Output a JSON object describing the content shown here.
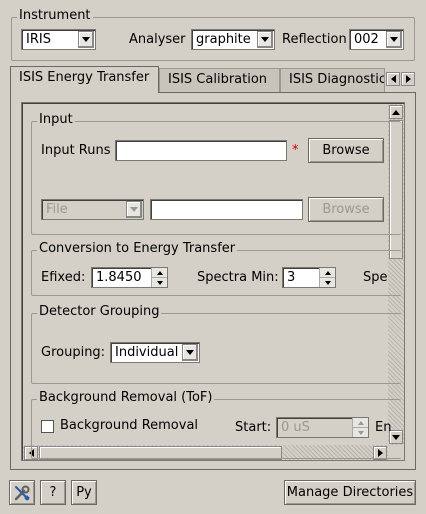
{
  "instrument": {
    "group_title": "Instrument",
    "instrument_value": "IRIS",
    "analyser_label": "Analyser",
    "analyser_value": "graphite",
    "reflection_label": "Reflection",
    "reflection_value": "002"
  },
  "tabs": [
    {
      "label": "ISIS Energy Transfer",
      "active": true
    },
    {
      "label": "ISIS Calibration",
      "active": false
    },
    {
      "label": "ISIS Diagnostic",
      "active": false
    }
  ],
  "input": {
    "group_title": "Input",
    "runs_label": "Input Runs",
    "runs_value": "",
    "required_marker": "*",
    "browse_label": "Browse",
    "file_type": "File",
    "file_value": "",
    "browse2_label": "Browse"
  },
  "conversion": {
    "group_title": "Conversion to Energy Transfer",
    "efixed_label": "Efixed:",
    "efixed_value": "1.8450",
    "spectra_min_label": "Spectra Min:",
    "spectra_min_value": "3",
    "spectra_max_label": "Spe"
  },
  "grouping": {
    "group_title": "Detector Grouping",
    "grouping_label": "Grouping:",
    "grouping_value": "Individual"
  },
  "background": {
    "group_title": "Background Removal (ToF)",
    "checkbox_label": "Background Removal",
    "checked": false,
    "start_label": "Start:",
    "start_value": "0 uS",
    "end_label": "En"
  },
  "footer": {
    "help_label": "?",
    "python_label": "Py",
    "manage_label": "Manage Directories"
  },
  "icons": {
    "settings": "wrench-screwdriver-icon"
  },
  "colors": {
    "window_bg": "#d4d0c8",
    "required_marker": "#cc0000"
  }
}
